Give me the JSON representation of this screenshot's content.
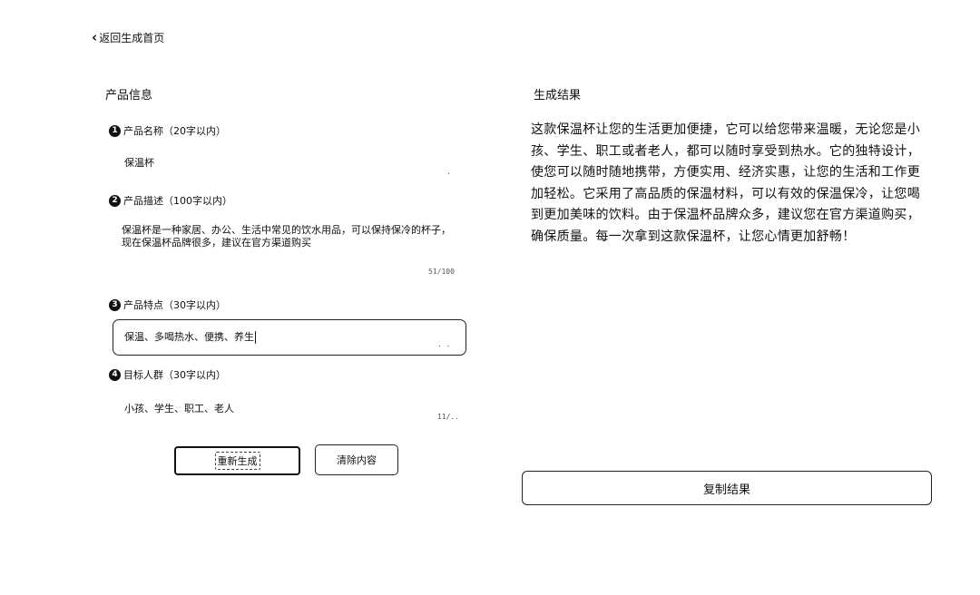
{
  "nav": {
    "back_label": "返回生成首页"
  },
  "left": {
    "title": "产品信息",
    "fields": [
      {
        "number": "1",
        "label": "产品名称（20字以内）",
        "value": "保温杯",
        "counter": "·"
      },
      {
        "number": "2",
        "label": "产品描述（100字以内）",
        "value": "保温杯是一种家居、办公、生活中常见的饮水用品，可以保持保冷的杯子，现在保温杯品牌很多，建议在官方渠道购买",
        "counter": "51/100"
      },
      {
        "number": "3",
        "label": "产品特点（30字以内）",
        "value": "保温、多喝热水、便携、养生",
        "counter": "·  ·"
      },
      {
        "number": "4",
        "label": "目标人群（30字以内）",
        "value": "小孩、学生、职工、老人",
        "counter": "11/.."
      }
    ],
    "generate_label": "重新生成",
    "clear_label": "清除内容"
  },
  "right": {
    "title": "生成结果",
    "result": "这款保温杯让您的生活更加便捷，它可以给您带来温暖，无论您是小孩、学生、职工或者老人，都可以随时享受到热水。它的独特设计，使您可以随时随地携带，方便实用、经济实惠，让您的生活和工作更加轻松。它采用了高品质的保温材料，可以有效的保温保冷，让您喝到更加美味的饮料。由于保温杯品牌众多，建议您在官方渠道购买，确保质量。每一次拿到这款保温杯，让您心情更加舒畅！",
    "copy_label": "复制结果"
  }
}
